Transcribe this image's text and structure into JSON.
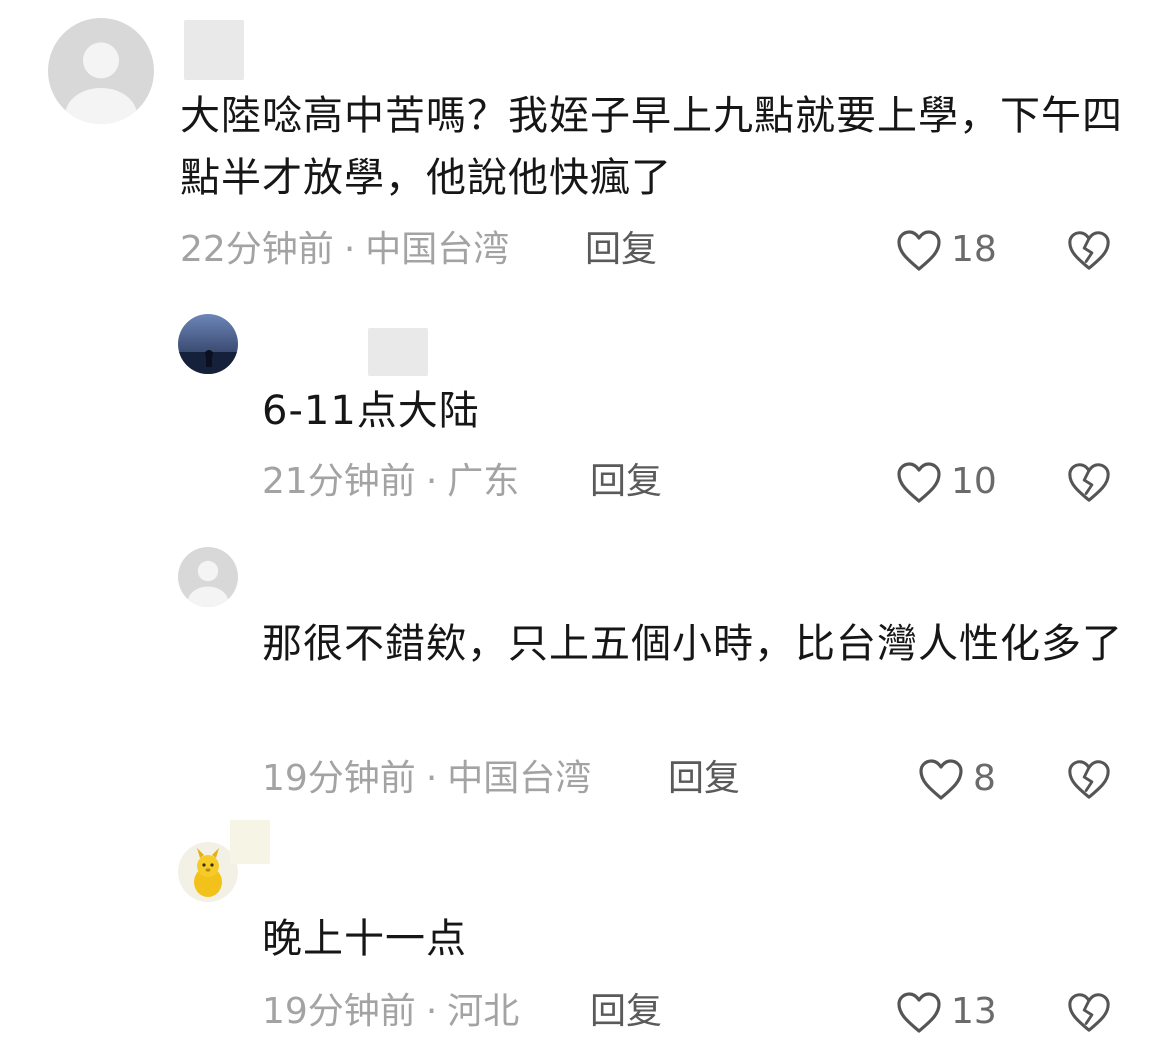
{
  "comments": [
    {
      "text": "大陸唸高中苦嗎？我姪子早上九點就要上學，下午四點半才放學，他說他快瘋了",
      "time": "22分钟前",
      "location": "中国台湾",
      "reply_label": "回复",
      "likes": "18",
      "avatar_icon": "default-user-avatar"
    },
    {
      "text": "6-11点大陆",
      "time": "21分钟前",
      "location": "广东",
      "reply_label": "回复",
      "likes": "10",
      "avatar_icon": "night-sky-avatar"
    },
    {
      "text": "那很不錯欸，只上五個小時，比台灣人性化多了",
      "time": "19分钟前",
      "location": "中国台湾",
      "reply_label": "回复",
      "likes": "8",
      "avatar_icon": "default-user-avatar"
    },
    {
      "text": "晚上十一点",
      "time": "19分钟前",
      "location": "河北",
      "reply_label": "回复",
      "likes": "13",
      "avatar_icon": "yellow-toy-avatar"
    }
  ],
  "separator": "·",
  "icons": {
    "like": "heart-icon",
    "dislike": "broken-heart-icon"
  },
  "colors": {
    "meta_text": "#a3a3a3",
    "reply_text": "#5a5a5a",
    "icon_stroke": "#555555"
  }
}
